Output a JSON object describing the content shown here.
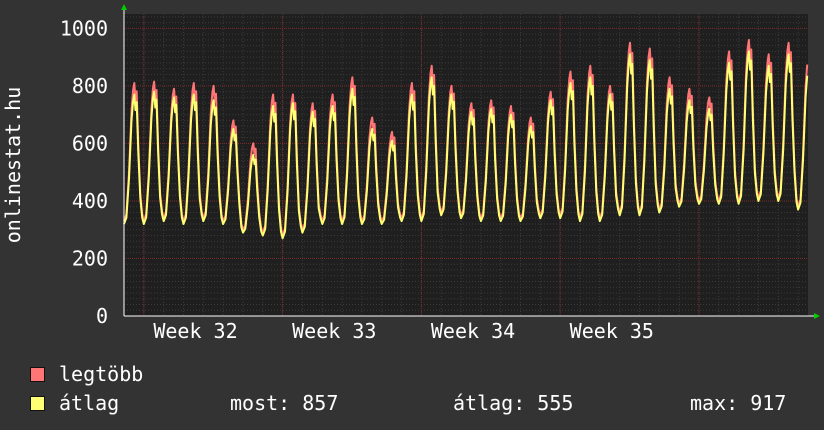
{
  "colors": {
    "background": "#333333",
    "plot_background": "#1f1f1f",
    "major_grid": "#7a2d2d",
    "minor_grid": "#3b3b3b",
    "series_max": "#ff7474",
    "series_avg": "#ffff74",
    "axis_arrow": "#00cc00"
  },
  "legend": [
    {
      "label": "legtöbb",
      "color": "#ff7474"
    },
    {
      "label": "átlag",
      "color": "#ffff74"
    }
  ],
  "stats": {
    "most": "most: 857",
    "atlag": "átlag: 555",
    "max": "max: 917"
  },
  "chart_data": {
    "type": "line",
    "title": "",
    "xlabel": "",
    "ylabel": "onlinestat.hu",
    "ylim": [
      0,
      1050
    ],
    "yticks": [
      0,
      200,
      400,
      600,
      800,
      1000
    ],
    "xtick_labels": [
      "Week 32",
      "Week 33",
      "Week 34",
      "Week 35"
    ],
    "x_unit": "days",
    "xlim": [
      0,
      34.5
    ],
    "xtick_positions": [
      3,
      10,
      17,
      24
    ],
    "grid": true,
    "legend_position": "bottom-left",
    "series": [
      {
        "name": "legtöbb",
        "color": "#ff7474",
        "daily_peak": [
          810,
          815,
          790,
          810,
          800,
          680,
          600,
          770,
          770,
          740,
          770,
          830,
          690,
          640,
          810,
          870,
          800,
          740,
          750,
          730,
          690,
          780,
          850,
          870,
          800,
          950,
          930,
          830,
          790,
          760,
          920,
          960,
          910,
          950,
          900
        ],
        "daily_low": [
          330,
          330,
          340,
          330,
          340,
          330,
          300,
          290,
          280,
          300,
          330,
          330,
          330,
          330,
          340,
          340,
          360,
          350,
          340,
          340,
          340,
          350,
          350,
          340,
          340,
          360,
          360,
          370,
          390,
          400,
          400,
          400,
          410,
          410,
          380
        ]
      },
      {
        "name": "átlag",
        "color": "#ffff74",
        "daily_peak": [
          770,
          780,
          760,
          770,
          750,
          650,
          560,
          730,
          740,
          710,
          730,
          790,
          650,
          610,
          770,
          830,
          770,
          710,
          720,
          700,
          660,
          750,
          810,
          830,
          770,
          910,
          890,
          790,
          750,
          720,
          880,
          920,
          870,
          910,
          860
        ],
        "daily_low": [
          320,
          320,
          330,
          320,
          330,
          320,
          290,
          280,
          270,
          290,
          320,
          320,
          320,
          320,
          330,
          330,
          350,
          340,
          330,
          330,
          330,
          340,
          340,
          330,
          330,
          350,
          350,
          360,
          380,
          390,
          390,
          390,
          400,
          400,
          370
        ]
      }
    ]
  }
}
